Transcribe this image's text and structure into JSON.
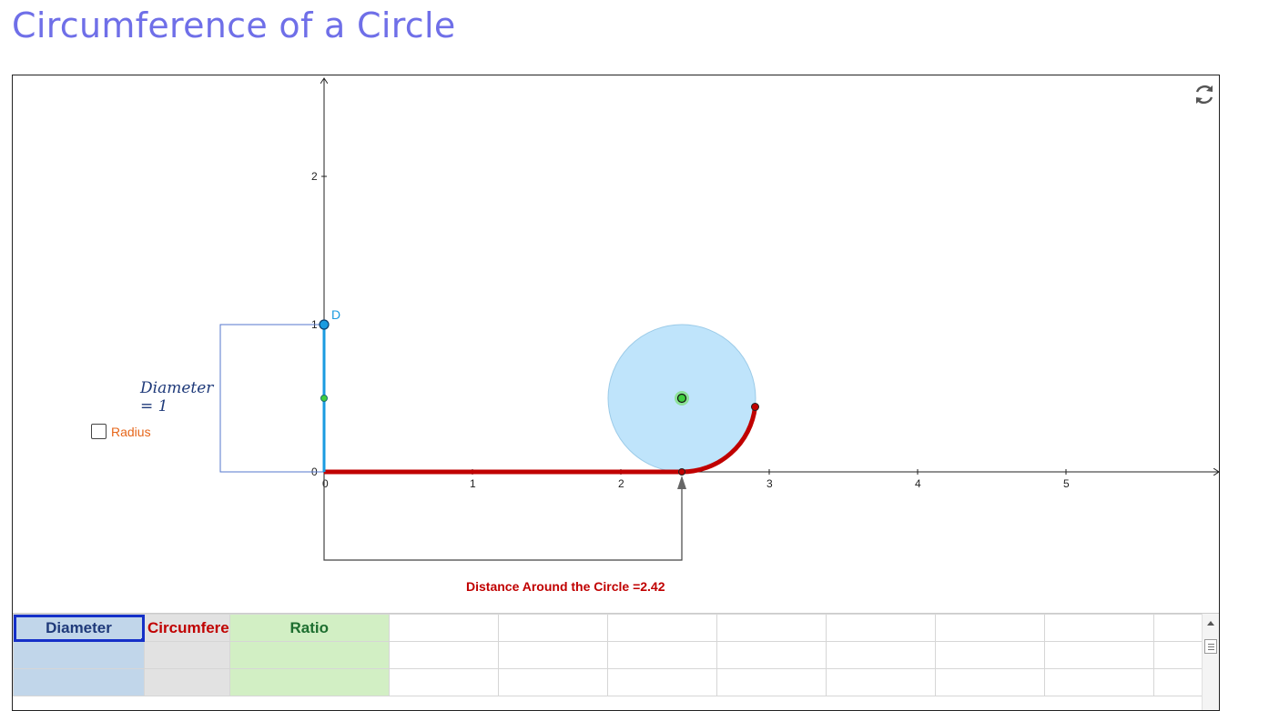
{
  "page": {
    "title": "Circumference of a Circle"
  },
  "graphics": {
    "axis_x_ticks": [
      "0",
      "1",
      "2",
      "3",
      "4",
      "5"
    ],
    "axis_y_ticks": [
      "0",
      "1",
      "2"
    ],
    "point_label": "D",
    "diameter_text_line1": "Diameter",
    "diameter_text_line2": "= 1",
    "radius_checkbox_label": "Radius",
    "radius_checked": false,
    "distance_text": "Distance Around the Circle =2.42",
    "reset_icon": "refresh-icon",
    "colors": {
      "diameter": "#1a9be0",
      "circumference": "#c00000",
      "circle_fill": "#bfe4fb",
      "center": "#3fcf3f"
    }
  },
  "spreadsheet": {
    "headers": [
      "Diameter",
      "Circumfere",
      "Ratio"
    ],
    "empty_columns": 8
  }
}
